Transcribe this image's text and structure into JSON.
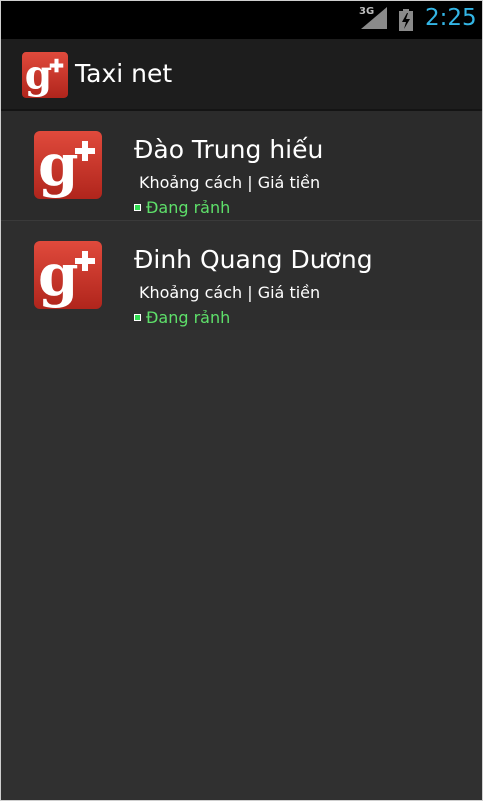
{
  "status_bar": {
    "network": "3G",
    "time": "2:25",
    "icons": [
      "signal-icon",
      "battery-charging-icon"
    ]
  },
  "action_bar": {
    "title": "Taxi net",
    "icon": "google-plus-icon"
  },
  "drivers": [
    {
      "name": "Đào Trung hiếu",
      "meta": "Khoảng cách | Giá tiền",
      "status": "Đang rảnh",
      "avatar": "google-plus-icon"
    },
    {
      "name": "Đinh Quang Dương",
      "meta": "Khoảng cách | Giá tiền",
      "status": "Đang rảnh",
      "avatar": "google-plus-icon"
    }
  ],
  "colors": {
    "accent": "#33b5e5",
    "status_available": "#5ee06a",
    "brand_red": "#c9302c"
  }
}
